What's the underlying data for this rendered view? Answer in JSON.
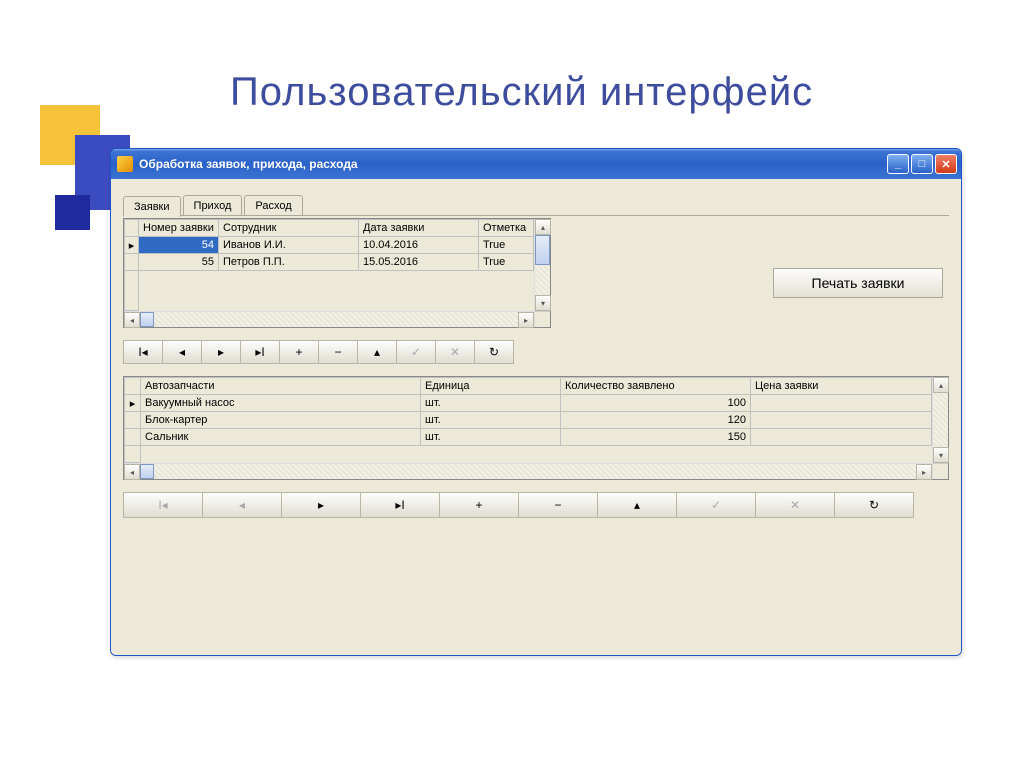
{
  "slide_title": "Пользовательский интерфейс",
  "window": {
    "title": "Обработка заявок, прихода, расхода",
    "btns": {
      "min": "_",
      "max": "□",
      "close": "✕"
    }
  },
  "tabs": {
    "t0": "Заявки",
    "t1": "Приход",
    "t2": "Расход"
  },
  "grid1": {
    "headers": {
      "c0": "Номер заявки",
      "c1": "Сотрудник",
      "c2": "Дата заявки",
      "c3": "Отметка"
    },
    "rows": {
      "r0": {
        "c0": "54",
        "c1": "Иванов И.И.",
        "c2": "10.04.2016",
        "c3": "True"
      },
      "r1": {
        "c0": "55",
        "c1": "Петров П.П.",
        "c2": "15.05.2016",
        "c3": "True"
      }
    },
    "row_marker": "▸"
  },
  "print_label": "Печать заявки",
  "nav": {
    "first": "І◂",
    "prev": "◂",
    "next": "▸",
    "last": "▸І",
    "add": "+",
    "del": "−",
    "edit": "▴",
    "post": "✓",
    "cancel": "✕",
    "refresh": "↻"
  },
  "grid2": {
    "headers": {
      "c0": "Автозапчасти",
      "c1": "Единица",
      "c2": "Количество заявлено",
      "c3": "Цена заявки"
    },
    "rows": {
      "r0": {
        "c0": "Вакуумный насос",
        "c1": "шт.",
        "c2": "100",
        "c3": ""
      },
      "r1": {
        "c0": "Блок-картер",
        "c1": "шт.",
        "c2": "120",
        "c3": ""
      },
      "r2": {
        "c0": "Сальник",
        "c1": "шт.",
        "c2": "150",
        "c3": ""
      }
    },
    "row_marker": "▸"
  },
  "scroll": {
    "up": "▴",
    "down": "▾",
    "left": "◂",
    "right": "▸"
  }
}
